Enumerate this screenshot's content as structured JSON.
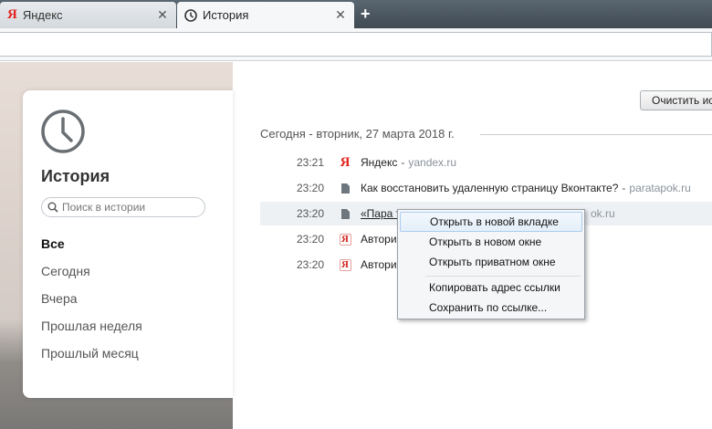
{
  "tabs": [
    {
      "label": "Яндекс",
      "icon": "yandex-logo-icon"
    },
    {
      "label": "История",
      "icon": "clock-icon"
    }
  ],
  "sidebar": {
    "title": "История",
    "search_placeholder": "Поиск в истории",
    "items": [
      {
        "label": "Все",
        "selected": true
      },
      {
        "label": "Сегодня"
      },
      {
        "label": "Вчера"
      },
      {
        "label": "Прошлая неделя"
      },
      {
        "label": "Прошлый месяц"
      }
    ]
  },
  "main": {
    "clear_button": "Очистить ист",
    "section_header": "Сегодня - вторник, 27 марта 2018 г.",
    "rows": [
      {
        "time": "23:21",
        "icon": "yandex-logo-icon",
        "title": "Яндекс",
        "domain": "yandex.ru"
      },
      {
        "time": "23:20",
        "icon": "document-icon",
        "title": "Как восстановить удаленную страницу Вконтакте?",
        "domain": "paratapok.ru"
      },
      {
        "time": "23:20",
        "icon": "document-icon",
        "title": "«Пара та",
        "domain": "ok.ru"
      },
      {
        "time": "23:20",
        "icon": "yandex-box-icon",
        "title": "Авториз"
      },
      {
        "time": "23:20",
        "icon": "yandex-box-icon",
        "title": "Авториз"
      }
    ]
  },
  "context_menu": {
    "items": [
      "Открыть в новой вкладке",
      "Открыть в новом окне",
      "Открыть приватном окне",
      "Копировать адрес ссылки",
      "Сохранить по ссылке..."
    ],
    "highlighted_index": 0
  },
  "colors": {
    "yandex_red": "#e52620",
    "tabstrip": "#4b565f",
    "menu_highlight": "#e4eff9"
  }
}
